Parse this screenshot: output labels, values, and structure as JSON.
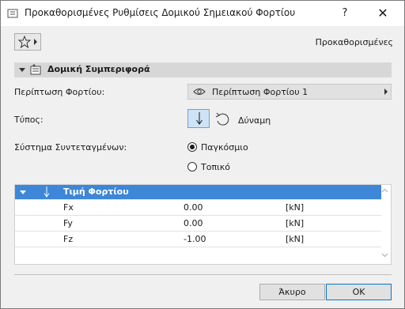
{
  "window": {
    "title": "Προκαθορισμένες Ρυθμίσεις Δομικού Σημειακού Φορτίου",
    "help_label": "?",
    "close_label": "✕"
  },
  "toolbar": {
    "favorites_icon": "star-icon",
    "defaults_label": "Προκαθορισμένες"
  },
  "section": {
    "title": "Δομική Συμπεριφορά"
  },
  "fields": {
    "load_case_label": "Περίπτωση Φορτίου:",
    "load_case_value": "Περίπτωση Φορτίου 1",
    "type_label": "Τύπος:",
    "type_value": "Δύναμη",
    "coord_label": "Σύστημα Συντεταγμένων:",
    "coord_options": [
      {
        "label": "Παγκόσμιο",
        "selected": true
      },
      {
        "label": "Τοπικό",
        "selected": false
      }
    ]
  },
  "grid": {
    "header": "Τιμή Φορτίου",
    "rows": [
      {
        "name": "Fx",
        "value": "0.00",
        "unit": "[kN]"
      },
      {
        "name": "Fy",
        "value": "0.00",
        "unit": "[kN]"
      },
      {
        "name": "Fz",
        "value": "-1.00",
        "unit": "[kN]"
      }
    ]
  },
  "buttons": {
    "cancel": "Άκυρο",
    "ok": "OK"
  },
  "colors": {
    "accent": "#3d86d8",
    "header_bg": "#d7d7d7",
    "selected_type_bg": "#cfe3f7"
  }
}
